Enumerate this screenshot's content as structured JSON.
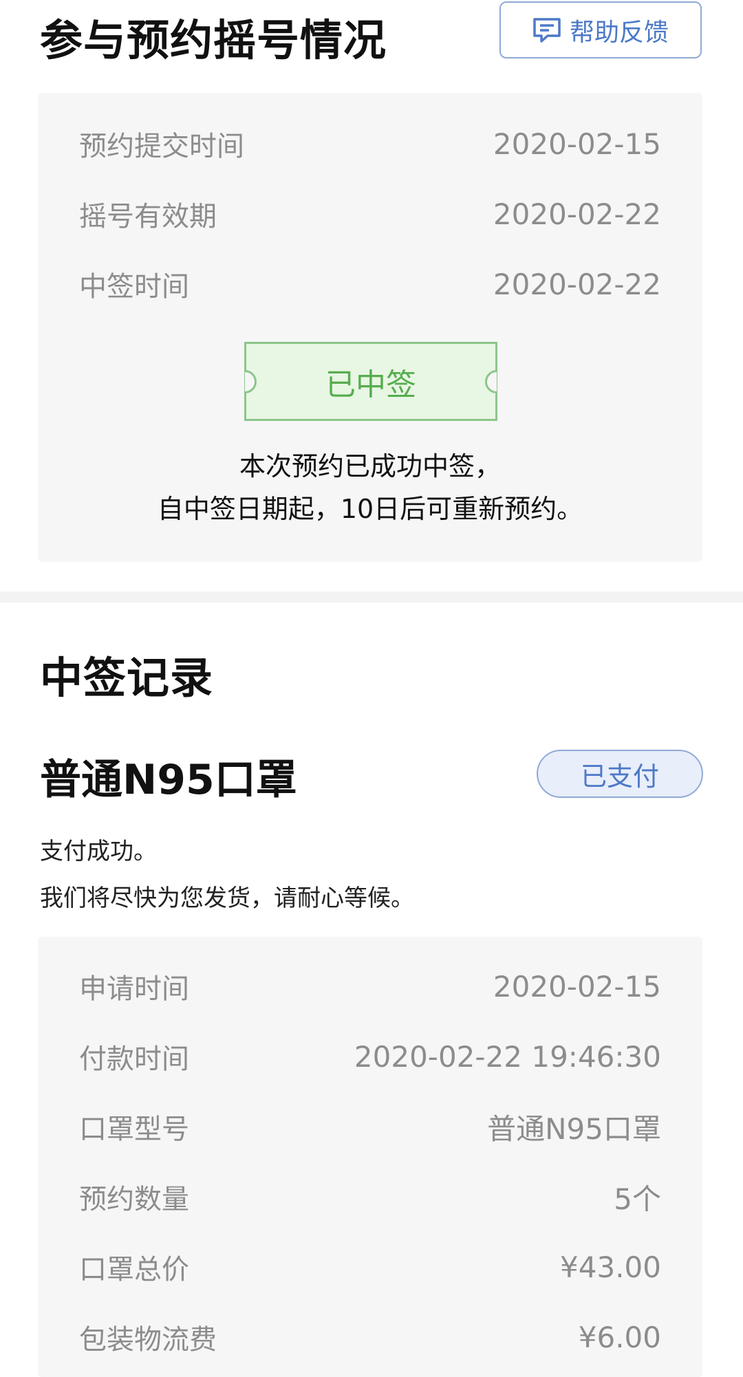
{
  "section1": {
    "title": "参与预约摇号情况",
    "help_label": "帮助反馈",
    "rows": [
      {
        "label": "预约提交时间",
        "value": "2020-02-15"
      },
      {
        "label": "摇号有效期",
        "value": "2020-02-22"
      },
      {
        "label": "中签时间",
        "value": "2020-02-22"
      }
    ],
    "status_ticket": "已中签",
    "message_line1": "本次预约已成功中签，",
    "message_line2": "自中签日期起，10日后可重新预约。"
  },
  "section2": {
    "title": "中签记录",
    "product": "普通N95口罩",
    "badge": "已支付",
    "note_line1": "支付成功。",
    "note_line2": "我们将尽快为您发货，请耐心等候。",
    "rows": [
      {
        "label": "申请时间",
        "value": "2020-02-15"
      },
      {
        "label": "付款时间",
        "value": "2020-02-22 19:46:30"
      },
      {
        "label": "口罩型号",
        "value": "普通N95口罩"
      },
      {
        "label": "预约数量",
        "value": "5个"
      },
      {
        "label": "口罩总价",
        "value": "¥43.00"
      },
      {
        "label": "包装物流费",
        "value": "¥6.00"
      }
    ]
  },
  "colors": {
    "accent_blue": "#4d79c7",
    "success_green": "#56ad4f",
    "card_bg": "#f6f6f6",
    "muted_text": "#8c8c8c"
  },
  "icons": {
    "help": "message-square-icon"
  }
}
